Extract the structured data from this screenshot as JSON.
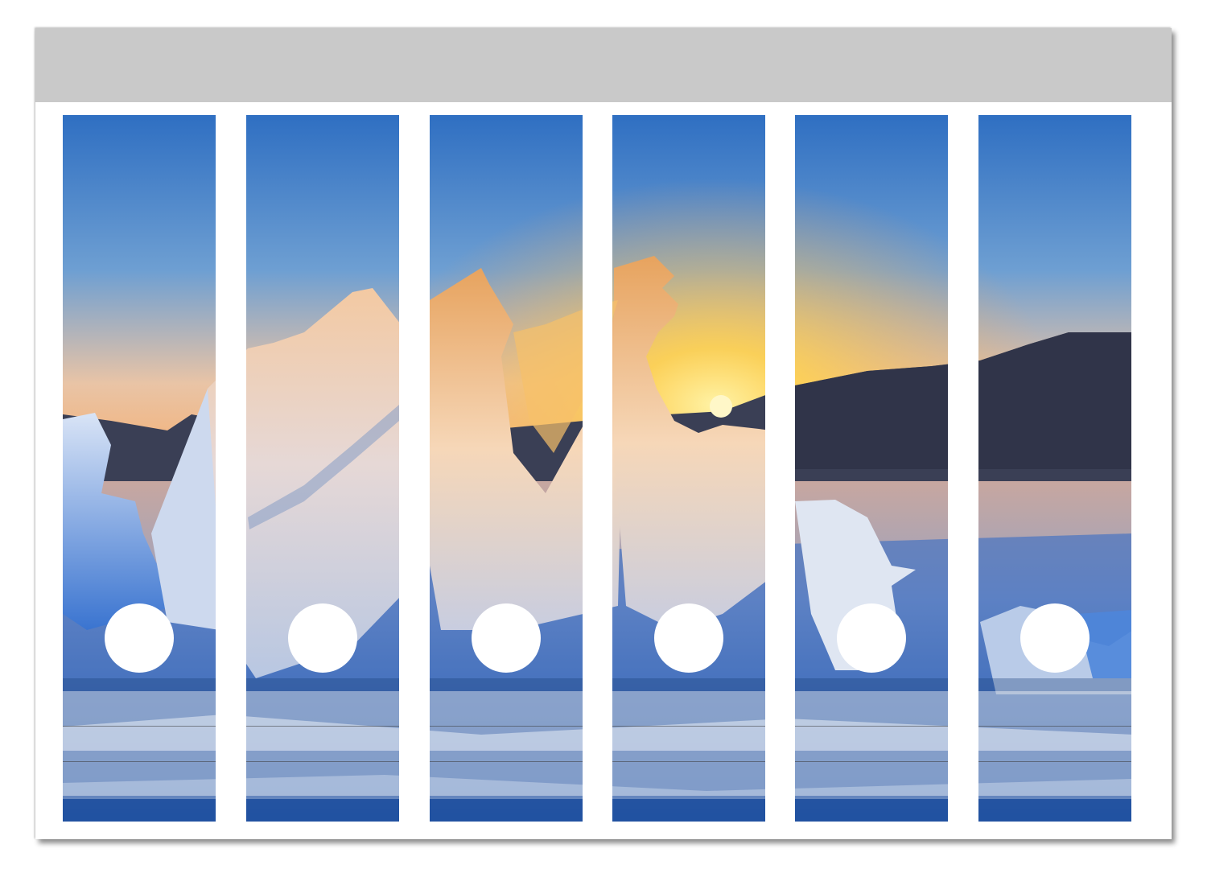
{
  "sheet": {
    "header_color": "#c9c9c9",
    "border_color": "#ffffff"
  },
  "labels": [
    {
      "name": "spine-label-1"
    },
    {
      "name": "spine-label-2"
    },
    {
      "name": "spine-label-3"
    },
    {
      "name": "spine-label-4"
    },
    {
      "name": "spine-label-5"
    },
    {
      "name": "spine-label-6"
    }
  ],
  "artwork": {
    "subject": "ice-shards-at-sunset-photo",
    "colors": {
      "sky_top": "#2f6fc2",
      "sky_mid": "#f0c9a0",
      "sun": "#ffd75a",
      "mountains": "#3a3f55",
      "water": "#2a66c7",
      "ice": "#dfe6f2"
    }
  }
}
